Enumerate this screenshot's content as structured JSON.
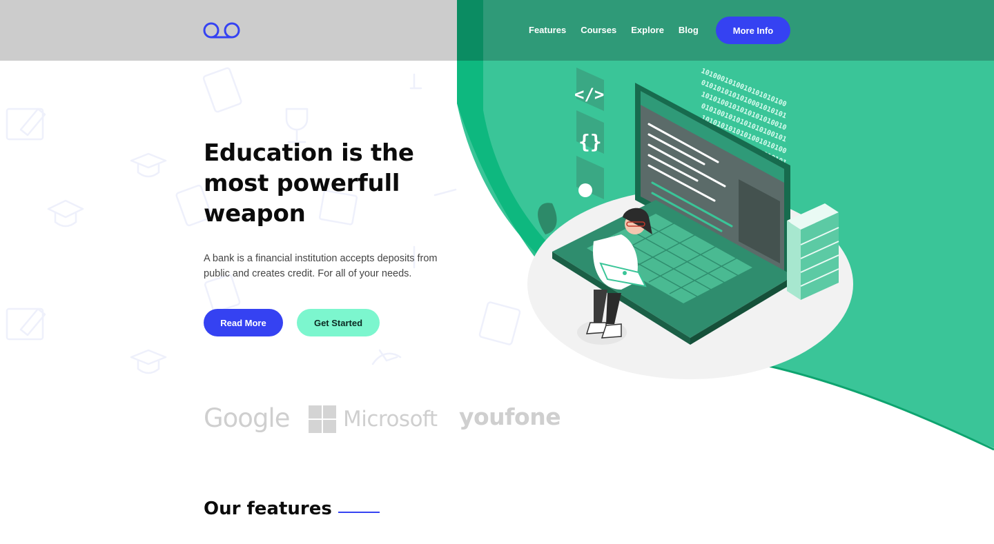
{
  "header": {
    "logo_name": "voicemail-logo-icon",
    "nav": [
      "Features",
      "Courses",
      "Explore",
      "Blog"
    ],
    "cta_label": "More Info"
  },
  "hero": {
    "title": "Education is the most powerfull weapon",
    "description": "A bank is a financial institution accepts deposits from public and creates credit. For all of your needs.",
    "primary_button": "Read More",
    "secondary_button": "Get Started",
    "illustration": "isometric-laptop-student-icon"
  },
  "brands": {
    "google": "Google",
    "microsoft": "Microsoft",
    "youfone": "youfone"
  },
  "features": {
    "title": "Our features"
  },
  "colors": {
    "accent_blue": "#3542f2",
    "mint": "#7cf6ce",
    "green": "#3ac598",
    "dark_green": "#0b8c62",
    "header_gray": "#cccccc",
    "brand_gray": "#cfcfcf"
  }
}
